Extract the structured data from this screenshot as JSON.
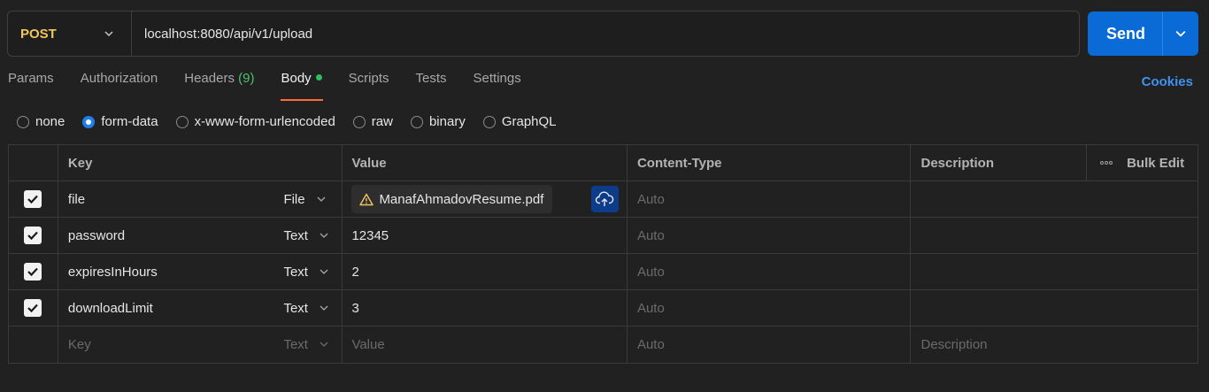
{
  "request": {
    "method": "POST",
    "url": "localhost:8080/api/v1/upload",
    "send_label": "Send"
  },
  "tabs": [
    {
      "label": "Params"
    },
    {
      "label": "Authorization"
    },
    {
      "label": "Headers",
      "count": "(9)"
    },
    {
      "label": "Body",
      "active": true,
      "indicator": "green-dot"
    },
    {
      "label": "Scripts"
    },
    {
      "label": "Tests"
    },
    {
      "label": "Settings"
    }
  ],
  "cookies_label": "Cookies",
  "body_types": {
    "options": [
      "none",
      "form-data",
      "x-www-form-urlencoded",
      "raw",
      "binary",
      "GraphQL"
    ],
    "selected": "form-data"
  },
  "table": {
    "headers": {
      "key": "Key",
      "value": "Value",
      "content_type": "Content-Type",
      "description": "Description",
      "bulk_edit": "Bulk Edit"
    },
    "rows": [
      {
        "checked": true,
        "key": "file",
        "type": "File",
        "value": "ManafAhmadovResume.pdf",
        "value_icon": "warning-icon",
        "content_type": "Auto",
        "description": ""
      },
      {
        "checked": true,
        "key": "password",
        "type": "Text",
        "value": "12345",
        "content_type": "Auto",
        "description": ""
      },
      {
        "checked": true,
        "key": "expiresInHours",
        "type": "Text",
        "value": "2",
        "content_type": "Auto",
        "description": ""
      },
      {
        "checked": true,
        "key": "downloadLimit",
        "type": "Text",
        "value": "3",
        "content_type": "Auto",
        "description": ""
      }
    ],
    "empty_row": {
      "key_placeholder": "Key",
      "type": "Text",
      "value_placeholder": "Value",
      "content_type_placeholder": "Auto",
      "description_placeholder": "Description"
    }
  },
  "colors": {
    "accent": "#ff6c37",
    "send": "#0a6ad6",
    "method_post": "#f0c75e",
    "link": "#3e92f0"
  }
}
